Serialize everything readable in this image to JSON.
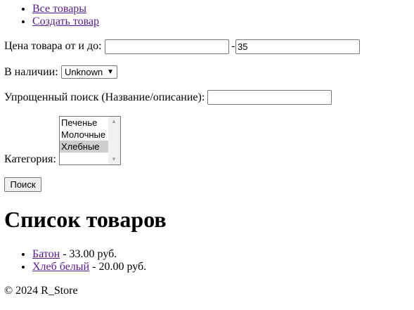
{
  "nav": [
    {
      "label": "Все товары"
    },
    {
      "label": "Создать товар"
    }
  ],
  "filters": {
    "price_label": "Цена товара от и до:",
    "price_from": "",
    "price_sep": "-",
    "price_to": "35",
    "stock_label": "В наличии:",
    "stock_value": "Unknown",
    "search_label": "Упрощенный поиск (Название/описание):",
    "search_value": "",
    "category_label": "Категория:",
    "categories": [
      {
        "label": "Печенье",
        "selected": false
      },
      {
        "label": "Молочные",
        "selected": false
      },
      {
        "label": "Хлебные",
        "selected": true
      }
    ],
    "submit": "Поиск"
  },
  "heading": "Список товаров",
  "products": [
    {
      "name": "Батон",
      "price": " - 33.00 руб."
    },
    {
      "name": "Хлеб белый",
      "price": " - 20.00 руб."
    }
  ],
  "footer": "© 2024 R_Store"
}
